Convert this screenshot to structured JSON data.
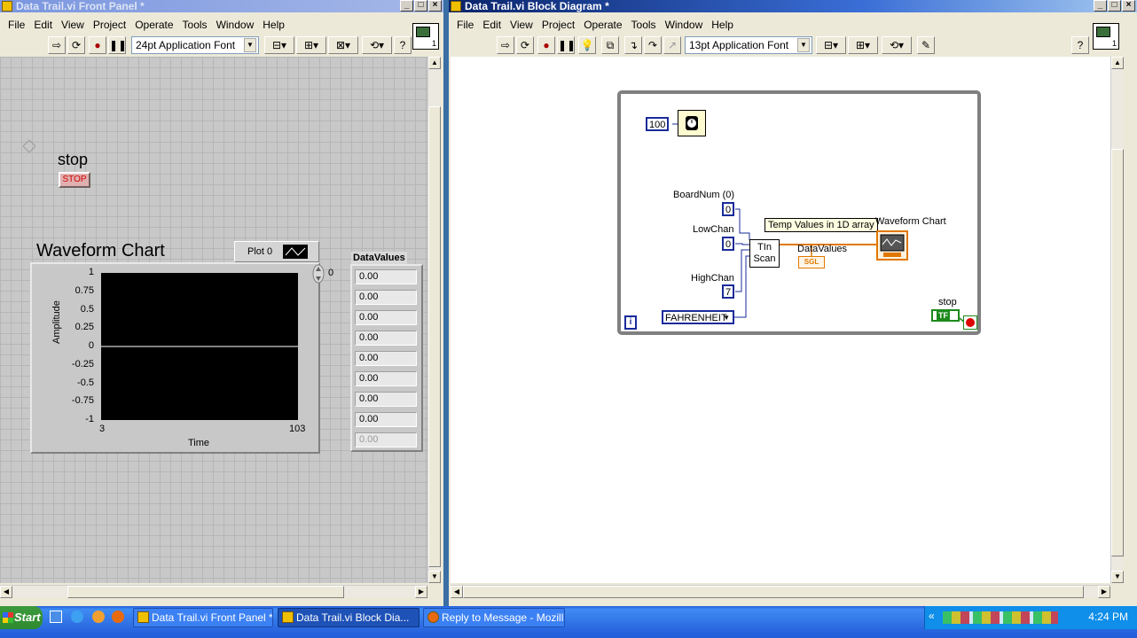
{
  "front_panel": {
    "title": "Data Trail.vi Front Panel *",
    "menu": [
      "File",
      "Edit",
      "View",
      "Project",
      "Operate",
      "Tools",
      "Window",
      "Help"
    ],
    "font_select": "24pt Application Font",
    "icon_num": "1",
    "stop": {
      "label": "stop",
      "button_text": "STOP"
    },
    "chart": {
      "title": "Waveform Chart",
      "legend_label": "Plot 0",
      "scroll_value": "0",
      "ylabel": "Amplitude",
      "xlabel": "Time",
      "yticks": [
        "1",
        "0.75",
        "0.5",
        "0.25",
        "0",
        "-0.25",
        "-0.5",
        "-0.75",
        "-1"
      ],
      "xticks": [
        "3",
        "103"
      ]
    },
    "data_values": {
      "label": "DataValues",
      "cells": [
        "0.00",
        "0.00",
        "0.00",
        "0.00",
        "0.00",
        "0.00",
        "0.00",
        "0.00",
        "0.00"
      ]
    }
  },
  "block_diagram": {
    "title": "Data Trail.vi Block Diagram *",
    "menu": [
      "File",
      "Edit",
      "View",
      "Project",
      "Operate",
      "Tools",
      "Window",
      "Help"
    ],
    "font_select": "13pt Application Font",
    "icon_num": "1",
    "wait_const": "100",
    "boardnum_label": "BoardNum (0)",
    "boardnum_val": "0",
    "lowchan_label": "LowChan",
    "lowchan_val": "0",
    "highchan_label": "HighChan",
    "highchan_val": "7",
    "scale_val": "FAHRENHEIT",
    "tin_scan": [
      "TIn",
      "Scan"
    ],
    "tip": "Temp Values in 1D array",
    "chart_label": "Waveform Chart",
    "datavalues_label": "DataValues",
    "sgl": "SGL",
    "stop_label": "stop",
    "tf": "TF",
    "loop_i": "i"
  },
  "taskbar": {
    "start": "Start",
    "tasks": [
      "Data Trail.vi Front Panel *",
      "Data Trail.vi Block Dia...",
      "Reply to Message - Mozill..."
    ],
    "clock": "4:24 PM"
  }
}
